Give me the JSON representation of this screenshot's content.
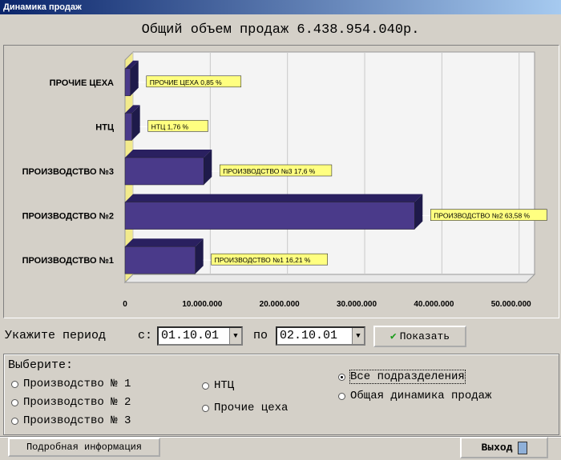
{
  "window": {
    "title": "Динамика продаж"
  },
  "summary": {
    "total_label": "Общий объем продаж 6.438.954.040р."
  },
  "chart_data": {
    "type": "bar",
    "orientation": "horizontal",
    "categories": [
      "ПРОИЗВОДСТВО №1",
      "ПРОИЗВОДСТВО №2",
      "ПРОИЗВОДСТВО №3",
      "НТЦ",
      "ПРОЧИЕ ЦЕХА"
    ],
    "values": [
      9100000,
      37500000,
      10200000,
      900000,
      700000
    ],
    "data_labels": [
      "ПРОИЗВОДСТВО №1   16,21 %",
      "ПРОИЗВОДСТВО №2   63,58 %",
      "ПРОИЗВОДСТВО №3   17,6 %",
      "НТЦ   1,76 %",
      "ПРОЧИЕ ЦЕХА   0,85 %"
    ],
    "xlim": [
      0,
      52000000
    ],
    "x_ticks": [
      0,
      10000000,
      20000000,
      30000000,
      40000000,
      50000000
    ],
    "x_tick_labels": [
      "0",
      "10.000.000",
      "20.000.000",
      "30.000.000",
      "40.000.000",
      "50.000.000"
    ],
    "grid": true,
    "colors": {
      "bar_front": "#4a3a8a",
      "bar_top": "#2a2060",
      "bar_side": "#1e1a4a",
      "label_bg": "#ffff80",
      "floor": "#f2ea8c",
      "back_wall": "#f4f4f4"
    }
  },
  "period": {
    "label": "Укажите период",
    "from_label": "с:",
    "from_value": "01.10.01",
    "to_label": "по",
    "to_value": "02.10.01",
    "show_button": "Показать"
  },
  "choose": {
    "title": "Выберите:",
    "options": [
      "Производство № 1",
      "Производство № 2",
      "Производство № 3",
      "НТЦ",
      "Прочие цеха",
      "Все подразделения",
      "Общая динамика продаж"
    ],
    "selected": "Все подразделения"
  },
  "footer": {
    "details_button": "Подробная информация",
    "exit_button": "Выход"
  }
}
